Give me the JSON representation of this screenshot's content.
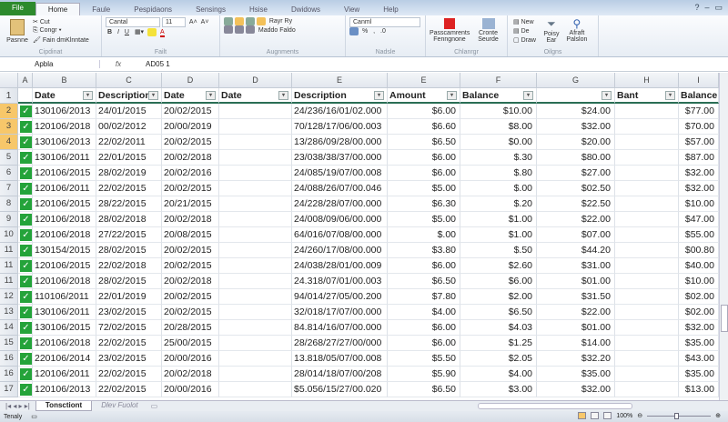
{
  "ribbon_tabs": [
    "File",
    "Home",
    "Faule",
    "Pespidaons",
    "Sensings",
    "Hsise",
    "Dwidows",
    "View",
    "Help"
  ],
  "ribbon": {
    "clipboard": {
      "paste": "Pasnne",
      "cut": "Cut",
      "copy": "Congr",
      "format": "Fain dmKlnntate",
      "label": "Cipdinat"
    },
    "font": {
      "name": "Cantal",
      "size": "11",
      "bold": "B",
      "italic": "I",
      "underline": "U",
      "label": "Failt"
    },
    "alignment": {
      "wrap": "Rayr",
      "wrap2": "Ry",
      "merge": "Maddo Faldo",
      "label": "Augnments"
    },
    "number": {
      "format": "Canml",
      "percent": "%",
      "label": "Nadsle"
    },
    "styles": {
      "cond": "Passcamrents Fenngnone",
      "format": "Cronte Seurde",
      "label": "Chlanrgr"
    },
    "cells": {
      "new": "New",
      "de": "De",
      "draw": "Draw",
      "sort": "Poisy Ear",
      "find": "Afraft Palslon",
      "label": "Oilgns"
    }
  },
  "formula_bar": {
    "name_box": "Apbla",
    "fx": "fx",
    "value": "AD05 1"
  },
  "columns": [
    "A",
    "B",
    "C",
    "D",
    "D",
    "E",
    "E",
    "F",
    "G",
    "H",
    "I"
  ],
  "headers": [
    "",
    "Date",
    "Description",
    "Date",
    "Date",
    "Description",
    "Amount",
    "Balance",
    "",
    "Bant",
    "Balance"
  ],
  "row_numbers": [
    "2",
    "3",
    "4",
    "5",
    "6",
    "7",
    "8",
    "9",
    "10",
    "11",
    "11",
    "11",
    "12",
    "13",
    "14",
    "15",
    "16",
    "16",
    "17"
  ],
  "rows": [
    [
      "130106/2013",
      "24/01/2015",
      "20/02/2015",
      "",
      "24/236/16/01/02.000",
      "$6.00",
      "$10.00",
      "$24.00",
      "",
      "$77.00"
    ],
    [
      "120106/2018",
      "00/02/2012",
      "20/00/2019",
      "",
      "70/128/17/06/00.003",
      "$6.60",
      "$8.00",
      "$32.00",
      "",
      "$70.00"
    ],
    [
      "130106/2013",
      "22/02/2011",
      "20/02/2015",
      "",
      "13/286/09/28/00.000",
      "$6.50",
      "$0.00",
      "$20.00",
      "",
      "$57.00"
    ],
    [
      "130106/2011",
      "22/01/2015",
      "20/02/2018",
      "",
      "23/038/38/37/00.000",
      "$6.00",
      "$.30",
      "$80.00",
      "",
      "$87.00"
    ],
    [
      "120106/2015",
      "28/02/2019",
      "20/02/2016",
      "",
      "24/085/19/07/00.008",
      "$6.00",
      "$.80",
      "$27.00",
      "",
      "$32.00"
    ],
    [
      "120106/2011",
      "22/02/2015",
      "20/02/2015",
      "",
      "24/088/26/07/00.046",
      "$5.00",
      "$.00",
      "$02.50",
      "",
      "$32.00"
    ],
    [
      "120106/2015",
      "28/22/2015",
      "20/21/2015",
      "",
      "24/228/28/07/00.000",
      "$6.30",
      "$.20",
      "$22.50",
      "",
      "$10.00"
    ],
    [
      "120106/2018",
      "28/02/2018",
      "20/02/2018",
      "",
      "24/008/09/06/00.000",
      "$5.00",
      "$1.00",
      "$22.00",
      "",
      "$47.00"
    ],
    [
      "120106/2018",
      "27/22/2015",
      "20/08/2015",
      "",
      "64/016/07/08/00.000",
      "$.00",
      "$1.00",
      "$07.00",
      "",
      "$55.00"
    ],
    [
      "130154/2015",
      "28/02/2015",
      "20/02/2015",
      "",
      "24/260/17/08/00.000",
      "$3.80",
      "$.50",
      "$44.20",
      "",
      "$00.80"
    ],
    [
      "120106/2015",
      "22/02/2018",
      "20/02/2015",
      "",
      "24/038/28/01/00.009",
      "$6.00",
      "$2.60",
      "$31.00",
      "",
      "$40.00"
    ],
    [
      "120106/2018",
      "28/02/2015",
      "20/02/2018",
      "",
      "24.318/07/01/00.003",
      "$6.50",
      "$6.00",
      "$01.00",
      "",
      "$10.00"
    ],
    [
      "110106/2011",
      "22/01/2019",
      "20/02/2015",
      "",
      "94/014/27/05/00.200",
      "$7.80",
      "$2.00",
      "$31.50",
      "",
      "$02.00"
    ],
    [
      "130106/2011",
      "23/02/2015",
      "20/02/2015",
      "",
      "32/018/17/07/00.000",
      "$4.00",
      "$6.50",
      "$22.00",
      "",
      "$02.00"
    ],
    [
      "130106/2015",
      "72/02/2015",
      "20/28/2015",
      "",
      "84.814/16/07/00.000",
      "$6.00",
      "$4.03",
      "$01.00",
      "",
      "$32.00"
    ],
    [
      "120106/2018",
      "22/02/2015",
      "25/00/2015",
      "",
      "28/268/27/27/00/000",
      "$6.00",
      "$1.25",
      "$14.00",
      "",
      "$35.00"
    ],
    [
      "220106/2014",
      "23/02/2015",
      "20/00/2016",
      "",
      "13.818/05/07/00.008",
      "$5.50",
      "$2.05",
      "$32.20",
      "",
      "$43.00"
    ],
    [
      "120106/2011",
      "22/02/2015",
      "20/02/2018",
      "",
      "28/014/18/07/00/208",
      "$5.90",
      "$4.00",
      "$35.00",
      "",
      "$35.00"
    ],
    [
      "120106/2013",
      "22/02/2015",
      "20/00/2016",
      "",
      "$5.056/15/27/00.020",
      "$6.50",
      "$3.00",
      "$32.00",
      "",
      "$13.00"
    ]
  ],
  "sheet_tabs": [
    "Tonsctiont",
    "Dlev Fuolot"
  ],
  "status": {
    "ready": "Tenaly",
    "zoom": "100%"
  },
  "colors": {
    "check": "#24a33a",
    "selected_row": "#f7c76a",
    "file_tab": "#2d8a2d"
  }
}
